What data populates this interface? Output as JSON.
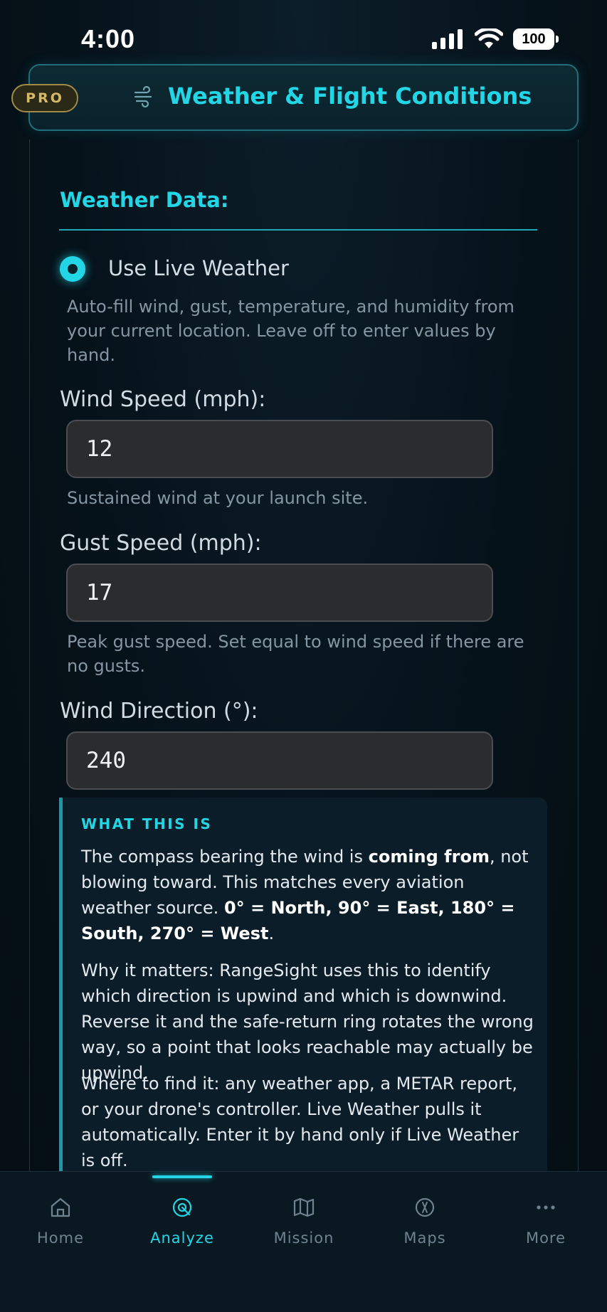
{
  "status_bar": {
    "time": "4:00",
    "battery": "100"
  },
  "header": {
    "badge": "PRO",
    "icon": "wind-icon",
    "title": "Weather & Flight Conditions"
  },
  "weather": {
    "section_title": "Weather Data:",
    "live_toggle": {
      "label": "Use Live Weather",
      "selected": true,
      "help": "Auto-fill wind, gust, temperature, and humidity from your current location. Leave off to enter values by hand."
    },
    "wind_speed": {
      "label": "Wind Speed (mph):",
      "value": "12",
      "help": "Sustained wind at your launch site."
    },
    "gust_speed": {
      "label": "Gust Speed (mph):",
      "value": "17",
      "help": "Peak gust speed. Set equal to wind speed if there are no gusts."
    },
    "wind_direction": {
      "label": "Wind Direction (°):",
      "value": "240"
    }
  },
  "info": {
    "kicker": "WHAT THIS IS",
    "p1_a": "The compass bearing the wind is ",
    "p1_b": "coming from",
    "p1_c": ", not blowing toward. This matches every aviation weather source. ",
    "p1_d": "0° = North, 90° = East, 180° = South, 270° = West",
    "p1_e": ".",
    "p2": "Why it matters: RangeSight uses this to identify which direction is upwind and which is downwind. Reverse it and the safe-return ring rotates the wrong way, so a point that looks reachable may actually be upwind.",
    "p3": "Where to find it: any weather app, a METAR report, or your drone's controller. Live Weather pulls it automatically. Enter it by hand only if Live Weather is off."
  },
  "tabs": [
    {
      "label": "Home",
      "icon": "home-icon",
      "active": false
    },
    {
      "label": "Analyze",
      "icon": "analyze-icon",
      "active": true
    },
    {
      "label": "Mission",
      "icon": "map-icon",
      "active": false
    },
    {
      "label": "Maps",
      "icon": "compass-icon",
      "active": false
    },
    {
      "label": "More",
      "icon": "more-icon",
      "active": false
    }
  ],
  "colors": {
    "accent": "#22d6e6",
    "pro": "#d7b964",
    "background": "#06121a"
  }
}
